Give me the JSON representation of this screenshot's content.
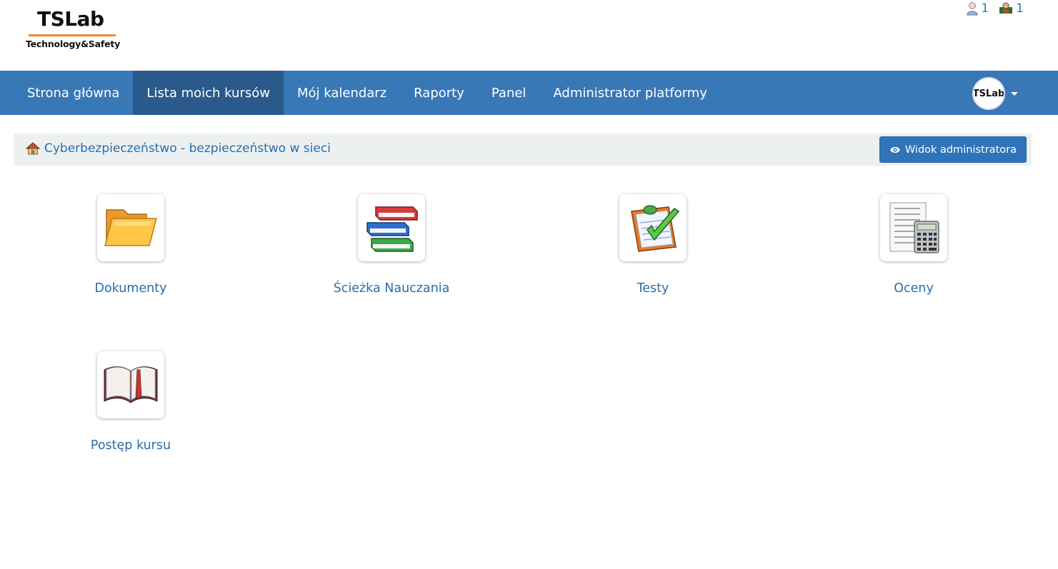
{
  "logo": {
    "main": "TSLab",
    "sub": "Technology&Safety"
  },
  "counters": [
    {
      "icon": "user-icon",
      "value": "1"
    },
    {
      "icon": "teacher-icon",
      "value": "1"
    }
  ],
  "nav": {
    "items": [
      {
        "label": "Strona główna"
      },
      {
        "label": "Lista moich kursów"
      },
      {
        "label": "Mój kalendarz"
      },
      {
        "label": "Raporty"
      },
      {
        "label": "Panel"
      },
      {
        "label": "Administrator platformy"
      }
    ],
    "active": "Lista moich kursów",
    "avatar_text": "TSLab"
  },
  "breadcrumb": {
    "course_title": "Cyberbezpieczeństwo - bezpieczeństwo w sieci"
  },
  "admin_button": {
    "label": "Widok administratora"
  },
  "tools": [
    {
      "label": "Dokumenty",
      "icon": "folder-icon"
    },
    {
      "label": "Ścieżka Nauczania",
      "icon": "books-icon"
    },
    {
      "label": "Testy",
      "icon": "quiz-checklist-icon"
    },
    {
      "label": "Oceny",
      "icon": "gradebook-calculator-icon"
    },
    {
      "label": "Postęp kursu",
      "icon": "open-book-icon"
    }
  ],
  "colors": {
    "navbar": "#3878b6",
    "nav_active": "#2a5a8c",
    "link": "#2b6ea8",
    "button": "#2f73b8",
    "crumb_bg": "#ecf0f1"
  }
}
